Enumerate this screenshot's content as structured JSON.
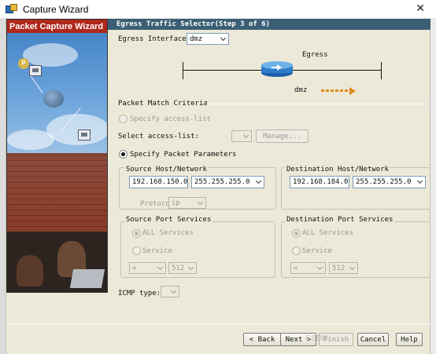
{
  "window": {
    "title": "Capture Wizard"
  },
  "left_panel": {
    "header": "Packet Capture Wizard",
    "badge": "P"
  },
  "step": {
    "title": "Egress Traffic Selector",
    "step_label": "(Step 3 of 6)"
  },
  "egress_interface": {
    "label": "Egress Interface:",
    "value": "dmz"
  },
  "diagram": {
    "egress_label": "Egress",
    "interface_label": "dmz",
    "arrow_color": "#e08b1c"
  },
  "packet_match": {
    "title": "Packet Match Criteria",
    "specify_acl_label": "Specify access-list",
    "select_acl_label": "Select access-list:",
    "select_acl_value": "",
    "manage_label": "Manage...",
    "specify_params_label": "Specify Packet Parameters",
    "specify_params_selected": true
  },
  "source": {
    "title": "Source Host/Network",
    "ip": "192.168.150.0",
    "mask": "255.255.255.0"
  },
  "destination": {
    "title": "Destination Host/Network",
    "ip": "192.168.184.0",
    "mask": "255.255.255.0"
  },
  "protocol": {
    "label": "Protocol:",
    "value": "ip"
  },
  "source_ports": {
    "title": "Source Port Services",
    "all_label": "ALL Services",
    "service_label": "Service",
    "operator": "=",
    "port": "512"
  },
  "destination_ports": {
    "title": "Destination Port Services",
    "all_label": "ALL Services",
    "service_label": "Service",
    "operator": "=",
    "port": "512"
  },
  "icmp": {
    "label": "ICMP type:",
    "value": ""
  },
  "buttons": {
    "back": "< Back",
    "next": "Next >",
    "finish": "Finish",
    "cancel": "Cancel",
    "help": "Help"
  },
  "watermark": "CSDN"
}
